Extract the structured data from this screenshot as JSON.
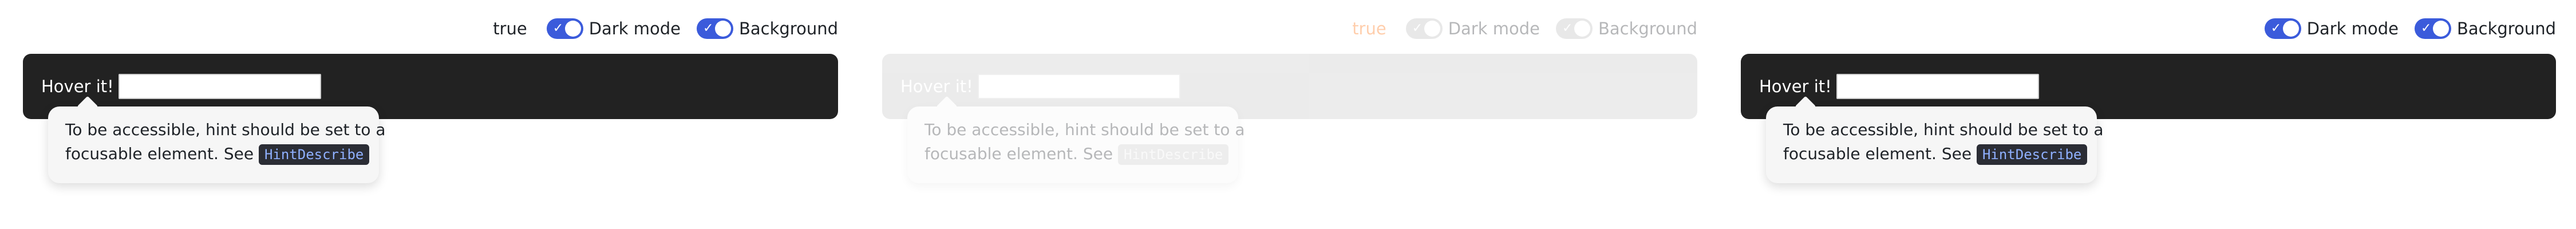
{
  "panels": [
    {
      "value_text": "true",
      "toggles": [
        {
          "label": "Dark mode"
        },
        {
          "label": "Background"
        }
      ],
      "bar_label": "Hover it!",
      "tooltip": {
        "line1": "To be accessible, hint should be set to a",
        "line2_prefix": "focusable element. See",
        "code": "HintDescribe"
      }
    },
    {
      "value_text": "true",
      "toggles": [
        {
          "label": "Dark mode"
        },
        {
          "label": "Background"
        }
      ],
      "bar_label": "Hover it!",
      "tooltip": {
        "line1": "To be accessible, hint should be set to a",
        "line2_prefix": "focusable element. See",
        "code": "HintDescribe"
      }
    },
    {
      "toggles": [
        {
          "label": "Dark mode"
        },
        {
          "label": "Background"
        }
      ],
      "bar_label": "Hover it!",
      "tooltip": {
        "line1": "To be accessible, hint should be set to a",
        "line2_prefix": "focusable element. See",
        "code": "HintDescribe"
      }
    }
  ],
  "colors": {
    "toggle_on": "#3b5bdb",
    "value_orange": "#ff6a00",
    "dark_bar": "#222222",
    "code_bg": "#2b2d35",
    "code_text": "#8fb0ff"
  }
}
